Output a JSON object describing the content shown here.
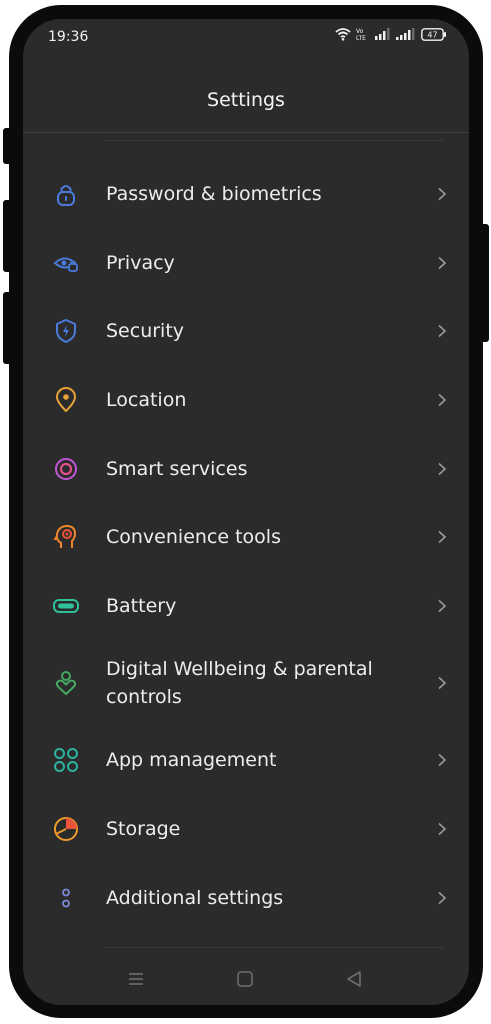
{
  "status_bar": {
    "time": "19:36",
    "network_label": "Vo\nLTE",
    "battery_level": "47"
  },
  "header": {
    "title": "Settings"
  },
  "settings_items": [
    {
      "label": "Password & biometrics",
      "icon": "lock-icon",
      "color": "#4a7bdc"
    },
    {
      "label": "Privacy",
      "icon": "eye-lock-icon",
      "color": "#4a7bdc"
    },
    {
      "label": "Security",
      "icon": "shield-icon",
      "color": "#4a7bdc"
    },
    {
      "label": "Location",
      "icon": "location-pin-icon",
      "color": "#e8a23a"
    },
    {
      "label": "Smart services",
      "icon": "smart-ring-icon",
      "color": "#c157d6"
    },
    {
      "label": "Convenience tools",
      "icon": "head-target-icon",
      "color": "#f0862e"
    },
    {
      "label": "Battery",
      "icon": "battery-icon",
      "color": "#2fc29a"
    },
    {
      "label": "Digital Wellbeing & parental controls",
      "icon": "wellbeing-heart-icon",
      "color": "#43a960"
    },
    {
      "label": "App management",
      "icon": "apps-grid-icon",
      "color": "#2ab4a0"
    },
    {
      "label": "Storage",
      "icon": "storage-pie-icon",
      "color": "#f09a2a"
    },
    {
      "label": "Additional settings",
      "icon": "dots-icon",
      "color": "#7a8ad6"
    }
  ],
  "nav": {
    "menu_icon": "menu-icon",
    "home_icon": "home-icon",
    "back_icon": "back-icon"
  }
}
